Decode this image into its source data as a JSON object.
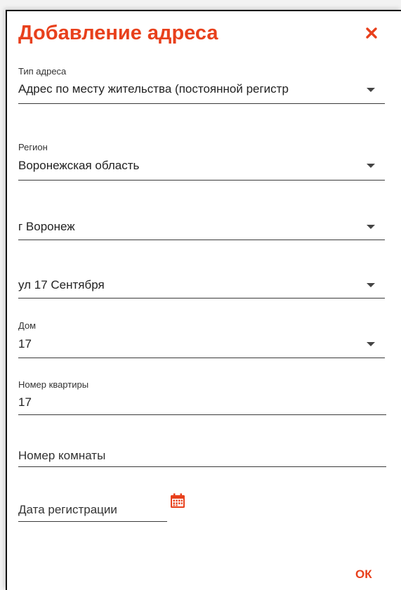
{
  "dialog": {
    "title": "Добавление адреса",
    "close_icon": "close-icon",
    "accent_color": "#e8401c"
  },
  "fields": {
    "address_type": {
      "label": "Тип адреса",
      "value": "Адрес по месту жительства (постоянной регистр"
    },
    "region": {
      "label": "Регион",
      "value": "Воронежская область"
    },
    "city": {
      "value": "г Воронеж"
    },
    "street": {
      "value": "ул 17 Сентября"
    },
    "house": {
      "label": "Дом",
      "value": "17"
    },
    "apartment": {
      "label": "Номер квартиры",
      "value": "17"
    },
    "room": {
      "placeholder": "Номер комнаты"
    },
    "registration_date": {
      "placeholder": "Дата регистрации",
      "icon": "calendar-icon"
    }
  },
  "footer": {
    "ok_label": "ОК"
  }
}
